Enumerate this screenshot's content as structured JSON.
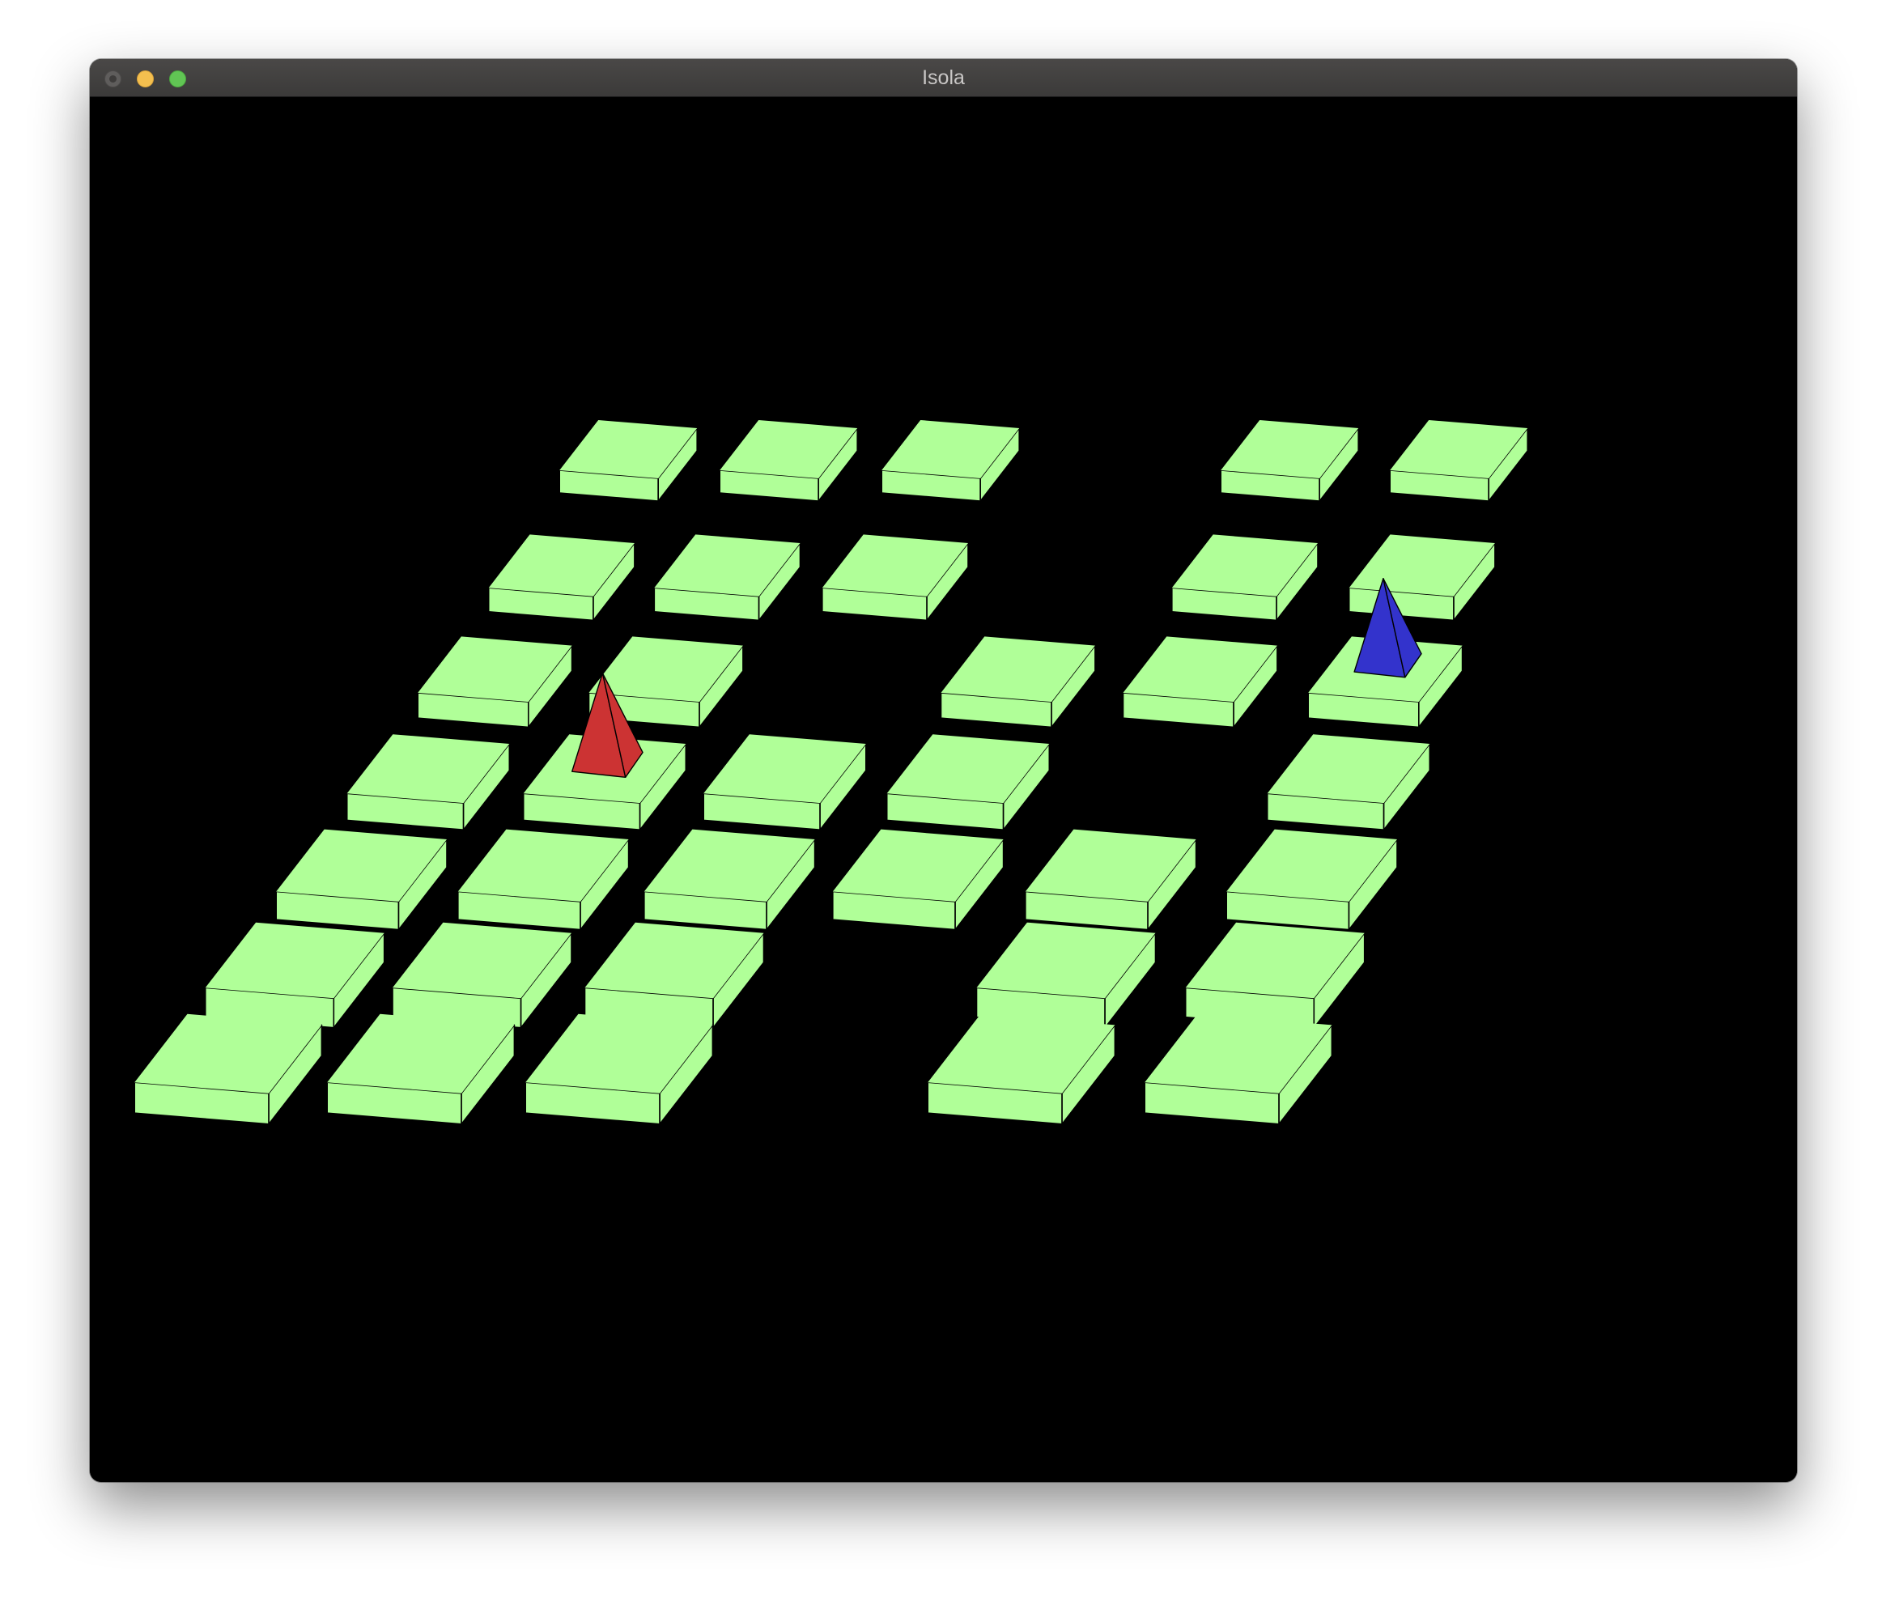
{
  "window": {
    "title": "Isola"
  },
  "colors": {
    "tile": "#b0ff98",
    "edge": "#000000",
    "background": "#000000",
    "player_red": "#cc3333",
    "player_blue": "#3333cc"
  },
  "board": {
    "columns": 6,
    "rows": 7,
    "missing_tiles": [
      {
        "col": 2,
        "row": 2
      },
      {
        "col": 3,
        "row": 0
      },
      {
        "col": 3,
        "row": 1
      },
      {
        "col": 3,
        "row": 5
      },
      {
        "col": 3,
        "row": 6
      },
      {
        "col": 4,
        "row": 3
      }
    ],
    "pieces": [
      {
        "name": "red-pawn-icon",
        "player": "red",
        "col": 1,
        "row": 3
      },
      {
        "name": "blue-pawn-icon",
        "player": "blue",
        "col": 5,
        "row": 2
      }
    ]
  }
}
